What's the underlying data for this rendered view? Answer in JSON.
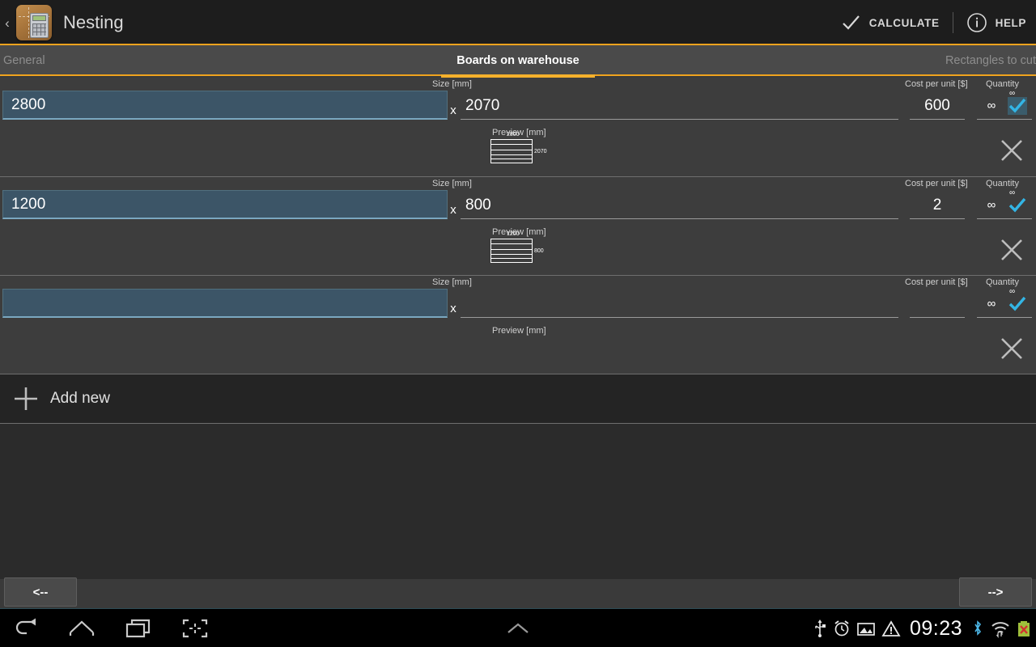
{
  "actionbar": {
    "up_glyph": "‹",
    "app_icon_name": "nesting-app-icon",
    "title": "Nesting",
    "calculate_label": "CALCULATE",
    "help_label": "HELP"
  },
  "tabs": [
    {
      "label": "General",
      "active": false
    },
    {
      "label": "Boards on warehouse",
      "active": true
    },
    {
      "label": "Rectangles to cut",
      "active": false
    }
  ],
  "labels": {
    "size": "Size [mm]",
    "cost": "Cost per unit [$]",
    "quantity": "Quantity",
    "preview": "Preview [mm]",
    "x_separator": "x",
    "infinity": "∞"
  },
  "rows": [
    {
      "width": "2800",
      "height": "2070",
      "cost": "600",
      "qty_value": "∞",
      "qty_mini": "∞",
      "qty_checked": true,
      "preview_top": "2800",
      "preview_right": "2070",
      "has_preview": true
    },
    {
      "width": "1200",
      "height": "800",
      "cost": "2",
      "qty_value": "∞",
      "qty_mini": "∞",
      "qty_checked": true,
      "preview_top": "1200",
      "preview_right": "800",
      "has_preview": true
    },
    {
      "width": "",
      "height": "",
      "cost": "",
      "qty_value": "∞",
      "qty_mini": "∞",
      "qty_checked": true,
      "preview_top": "",
      "preview_right": "",
      "has_preview": false
    }
  ],
  "add_new": {
    "label": "Add new"
  },
  "footer": {
    "prev_label": "<--",
    "next_label": "-->"
  },
  "systembar": {
    "back_icon": "back-icon",
    "home_icon": "home-icon",
    "recents_icon": "recents-icon",
    "screenshot_icon": "screenshot-icon",
    "expand_icon": "chevron-up-icon",
    "usb_icon": "usb-icon",
    "alarm_icon": "alarm-icon",
    "image_icon": "image-icon",
    "warning_icon": "warning-icon",
    "clock": "09:23",
    "bluetooth_icon": "bluetooth-icon",
    "wifi_icon": "wifi-icon",
    "battery_icon": "battery-error-icon"
  },
  "colors": {
    "accent": "#f0a31e",
    "focus_field": "#3c5567",
    "check_blue": "#33b5e5",
    "actionbar_bg": "#1d1d1d",
    "row_bg": "#3d3d3d"
  }
}
